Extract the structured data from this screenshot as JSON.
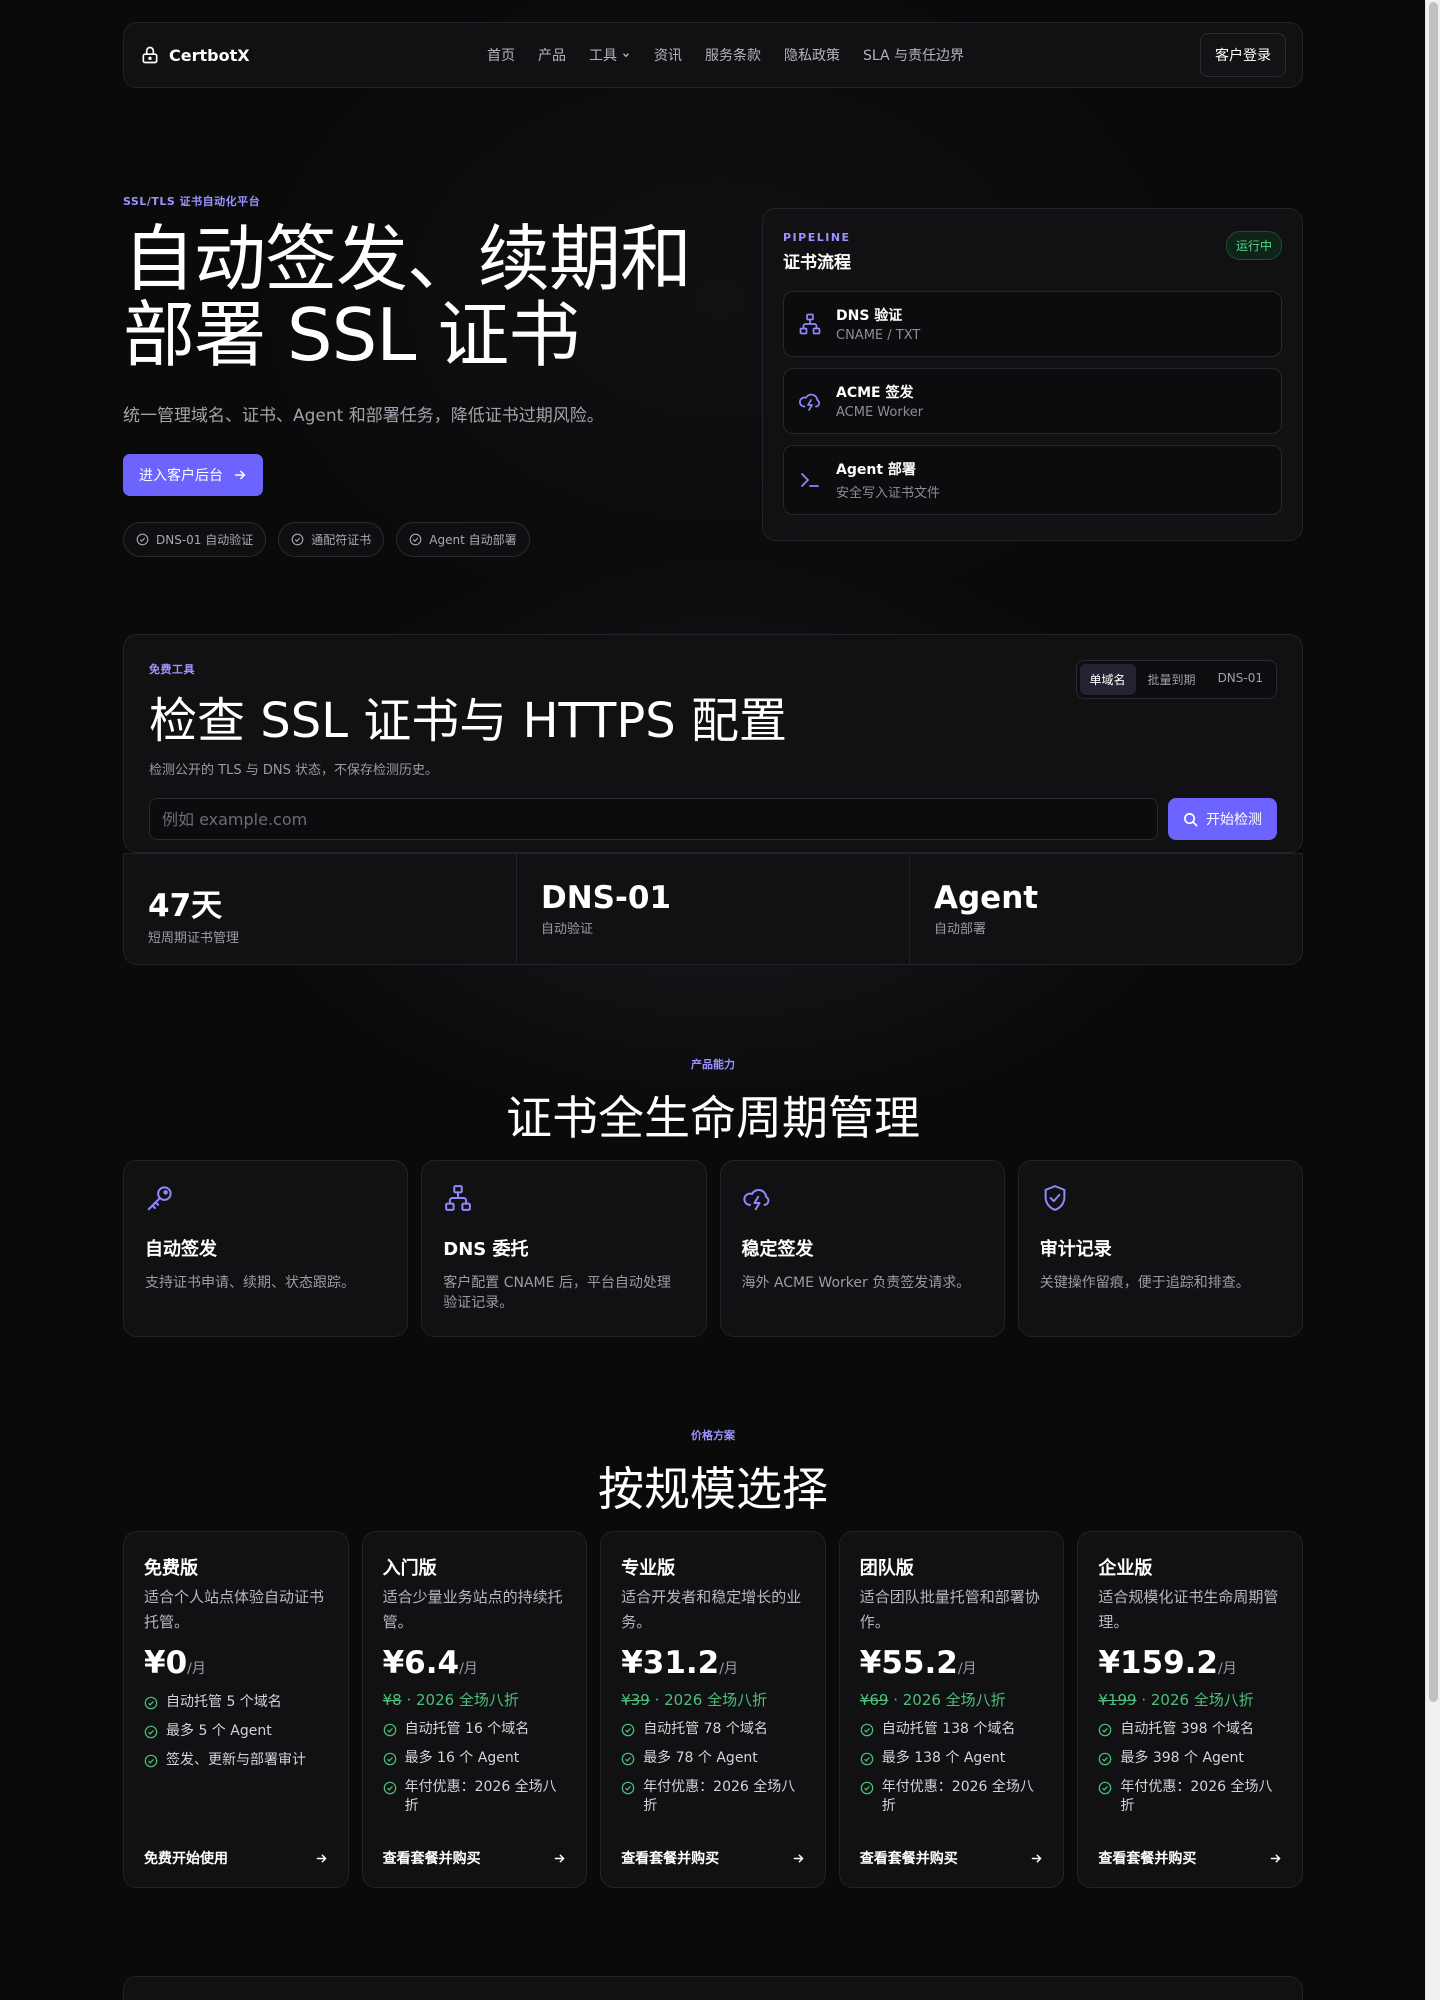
{
  "brand": {
    "name": "CertbotX"
  },
  "nav": {
    "links": [
      "首页",
      "产品",
      "工具",
      "资讯",
      "服务条款",
      "隐私政策",
      "SLA 与责任边界"
    ],
    "login": "客户登录"
  },
  "hero": {
    "eyebrow": "SSL/TLS 证书自动化平台",
    "title_line1": "自动签发、续期和",
    "title_line2": "部署 SSL 证书",
    "subtitle": "统一管理域名、证书、Agent 和部署任务，降低证书过期风险。",
    "cta": "进入客户后台",
    "chips": [
      "DNS-01 自动验证",
      "通配符证书",
      "Agent 自动部署"
    ]
  },
  "pipeline": {
    "eyebrow": "PIPELINE",
    "title": "证书流程",
    "status": "运行中",
    "steps": [
      {
        "name": "DNS 验证",
        "desc": "CNAME / TXT",
        "icon": "network-icon"
      },
      {
        "name": "ACME 签发",
        "desc": "ACME Worker",
        "icon": "cloud-lightning-icon"
      },
      {
        "name": "Agent 部署",
        "desc": "安全写入证书文件",
        "icon": "terminal-icon"
      }
    ]
  },
  "checker": {
    "eyebrow": "免费工具",
    "title": "检查 SSL 证书与 HTTPS 配置",
    "desc": "检测公开的 TLS 与 DNS 状态，不保存检测历史。",
    "tabs": [
      "单域名",
      "批量到期",
      "DNS-01"
    ],
    "active_tab": "单域名",
    "placeholder": "例如 example.com",
    "value": "",
    "button": "开始检测"
  },
  "stats": [
    {
      "value": "47天",
      "label": "短周期证书管理"
    },
    {
      "value": "DNS-01",
      "label": "自动验证"
    },
    {
      "value": "Agent",
      "label": "自动部署"
    }
  ],
  "features": {
    "eyebrow": "产品能力",
    "title": "证书全生命周期管理",
    "items": [
      {
        "title": "自动签发",
        "desc": "支持证书申请、续期、状态跟踪。",
        "icon": "key-icon"
      },
      {
        "title": "DNS 委托",
        "desc": "客户配置 CNAME 后，平台自动处理验证记录。",
        "icon": "network-icon"
      },
      {
        "title": "稳定签发",
        "desc": "海外 ACME Worker 负责签发请求。",
        "icon": "cloud-lightning-icon"
      },
      {
        "title": "审计记录",
        "desc": "关键操作留痕，便于追踪和排查。",
        "icon": "shield-check-icon"
      }
    ]
  },
  "pricing": {
    "eyebrow": "价格方案",
    "title": "按规模选择",
    "per": "/月",
    "plans": [
      {
        "name": "免费版",
        "desc": "适合个人站点体验自动证书托管。",
        "price": "¥0",
        "old": "",
        "promo": "",
        "feats": [
          "自动托管 5 个域名",
          "最多 5 个 Agent",
          "签发、更新与部署审计"
        ],
        "cta": "免费开始使用"
      },
      {
        "name": "入门版",
        "desc": "适合少量业务站点的持续托管。",
        "price": "¥6.4",
        "old": "¥8",
        "promo": " · 2026 全场八折",
        "feats": [
          "自动托管 16 个域名",
          "最多 16 个 Agent",
          "年付优惠：2026 全场八折"
        ],
        "cta": "查看套餐并购买"
      },
      {
        "name": "专业版",
        "desc": "适合开发者和稳定增长的业务。",
        "price": "¥31.2",
        "old": "¥39",
        "promo": " · 2026 全场八折",
        "feats": [
          "自动托管 78 个域名",
          "最多 78 个 Agent",
          "年付优惠：2026 全场八折"
        ],
        "cta": "查看套餐并购买"
      },
      {
        "name": "团队版",
        "desc": "适合团队批量托管和部署协作。",
        "price": "¥55.2",
        "old": "¥69",
        "promo": " · 2026 全场八折",
        "feats": [
          "自动托管 138 个域名",
          "最多 138 个 Agent",
          "年付优惠：2026 全场八折"
        ],
        "cta": "查看套餐并购买"
      },
      {
        "name": "企业版",
        "desc": "适合规模化证书生命周期管理。",
        "price": "¥159.2",
        "old": "¥199",
        "promo": " · 2026 全场八折",
        "feats": [
          "自动托管 398 个域名",
          "最多 398 个 Agent",
          "年付优惠：2026 全场八折"
        ],
        "cta": "查看套餐并购买"
      }
    ]
  },
  "colors": {
    "accent": "#6d63ff",
    "eyebrow": "#9b93ff",
    "success": "#4cc07a",
    "background": "#0a0a0b"
  }
}
